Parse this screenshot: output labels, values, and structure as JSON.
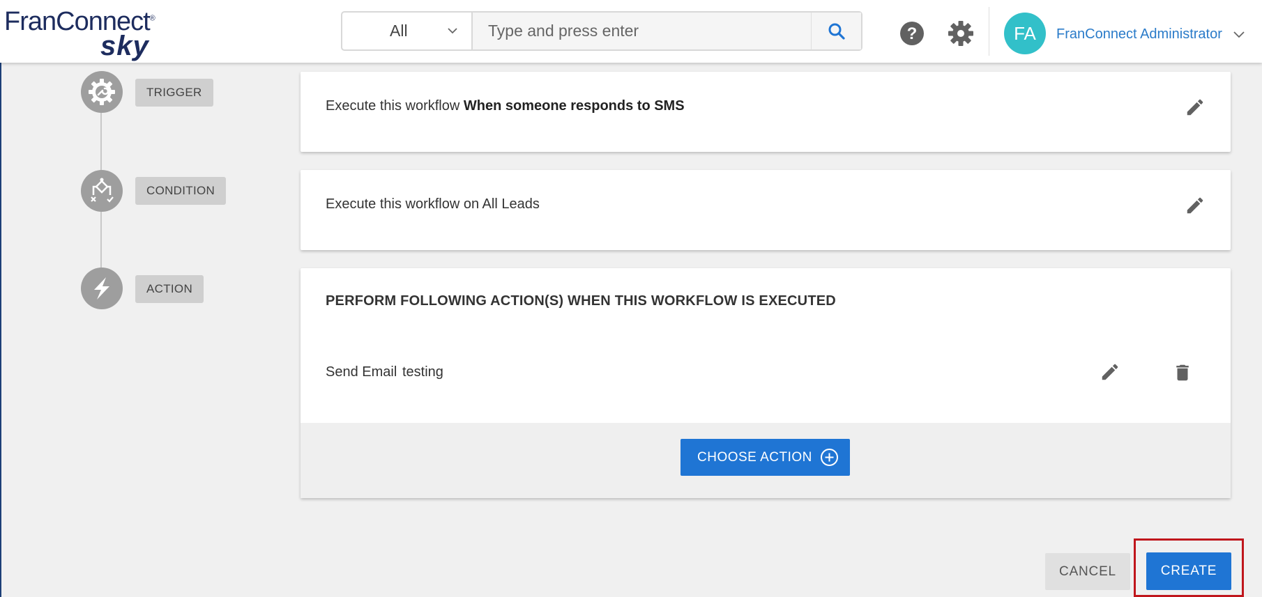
{
  "header": {
    "logo": {
      "main": "FranConnect",
      "sub": "sky"
    },
    "search": {
      "select_value": "All",
      "placeholder": "Type and press enter"
    },
    "user": {
      "initials": "FA",
      "name": "FranConnect Administrator"
    }
  },
  "steps": [
    {
      "label": "TRIGGER",
      "icon": "trigger-gear-icon"
    },
    {
      "label": "CONDITION",
      "icon": "condition-flow-icon"
    },
    {
      "label": "ACTION",
      "icon": "lightning-icon"
    }
  ],
  "trigger_card": {
    "prefix": "Execute this workflow ",
    "emphasis": "When someone responds to SMS"
  },
  "condition_card": {
    "text": "Execute this workflow on All Leads"
  },
  "action_card": {
    "title": "PERFORM FOLLOWING ACTION(S) WHEN THIS WORKFLOW IS EXECUTED",
    "action_type": "Send Email",
    "action_value": "testing",
    "choose_label": "CHOOSE ACTION"
  },
  "footer": {
    "cancel_label": "CANCEL",
    "create_label": "CREATE"
  },
  "colors": {
    "primary": "#1f75d4",
    "avatar": "#32c0c9",
    "highlight": "#c0161c",
    "brand": "#1d2c5e"
  }
}
